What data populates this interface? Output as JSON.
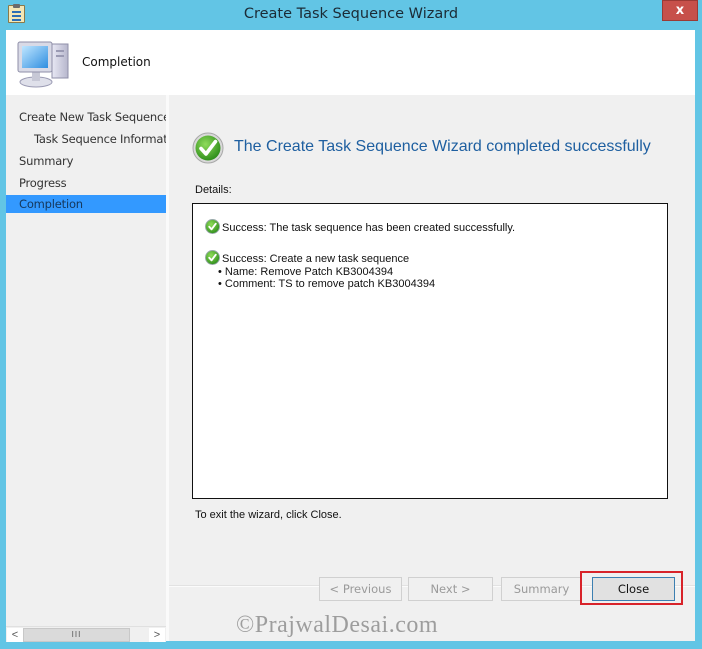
{
  "window": {
    "title": "Create Task Sequence Wizard",
    "close_label": "x"
  },
  "header": {
    "title": "Completion",
    "icon": "computer-icon"
  },
  "nav": {
    "items": [
      {
        "label": "Create New Task Sequence",
        "level": 0,
        "active": false
      },
      {
        "label": "Task Sequence Information",
        "level": 1,
        "active": false
      },
      {
        "label": "Summary",
        "level": 0,
        "active": false
      },
      {
        "label": "Progress",
        "level": 0,
        "active": false
      },
      {
        "label": "Completion",
        "level": 0,
        "active": true
      }
    ],
    "scroll": {
      "left": "<",
      "right": ">",
      "thumb": "III"
    }
  },
  "content": {
    "headline": "The Create Task Sequence Wizard completed successfully",
    "details_label": "Details:",
    "details": [
      {
        "text": "Success: The task sequence has been created successfully.",
        "icon": "success-check-icon"
      },
      {
        "text": "Success: Create a new task sequence",
        "icon": "success-check-icon",
        "bullets": [
          "Name: Remove Patch KB3004394",
          "Comment: TS to remove patch KB3004394"
        ]
      }
    ],
    "exit_text": "To exit the wizard, click Close."
  },
  "buttons": {
    "previous": "< Previous",
    "next": "Next >",
    "summary": "Summary",
    "close": "Close"
  },
  "watermark": "©PrajwalDesai.com",
  "colors": {
    "titlebar": "#62c5e5",
    "accent_selected": "#3399ff",
    "headline": "#1e5fa0",
    "close_button": "#c7504a",
    "highlight": "#d8232a"
  }
}
